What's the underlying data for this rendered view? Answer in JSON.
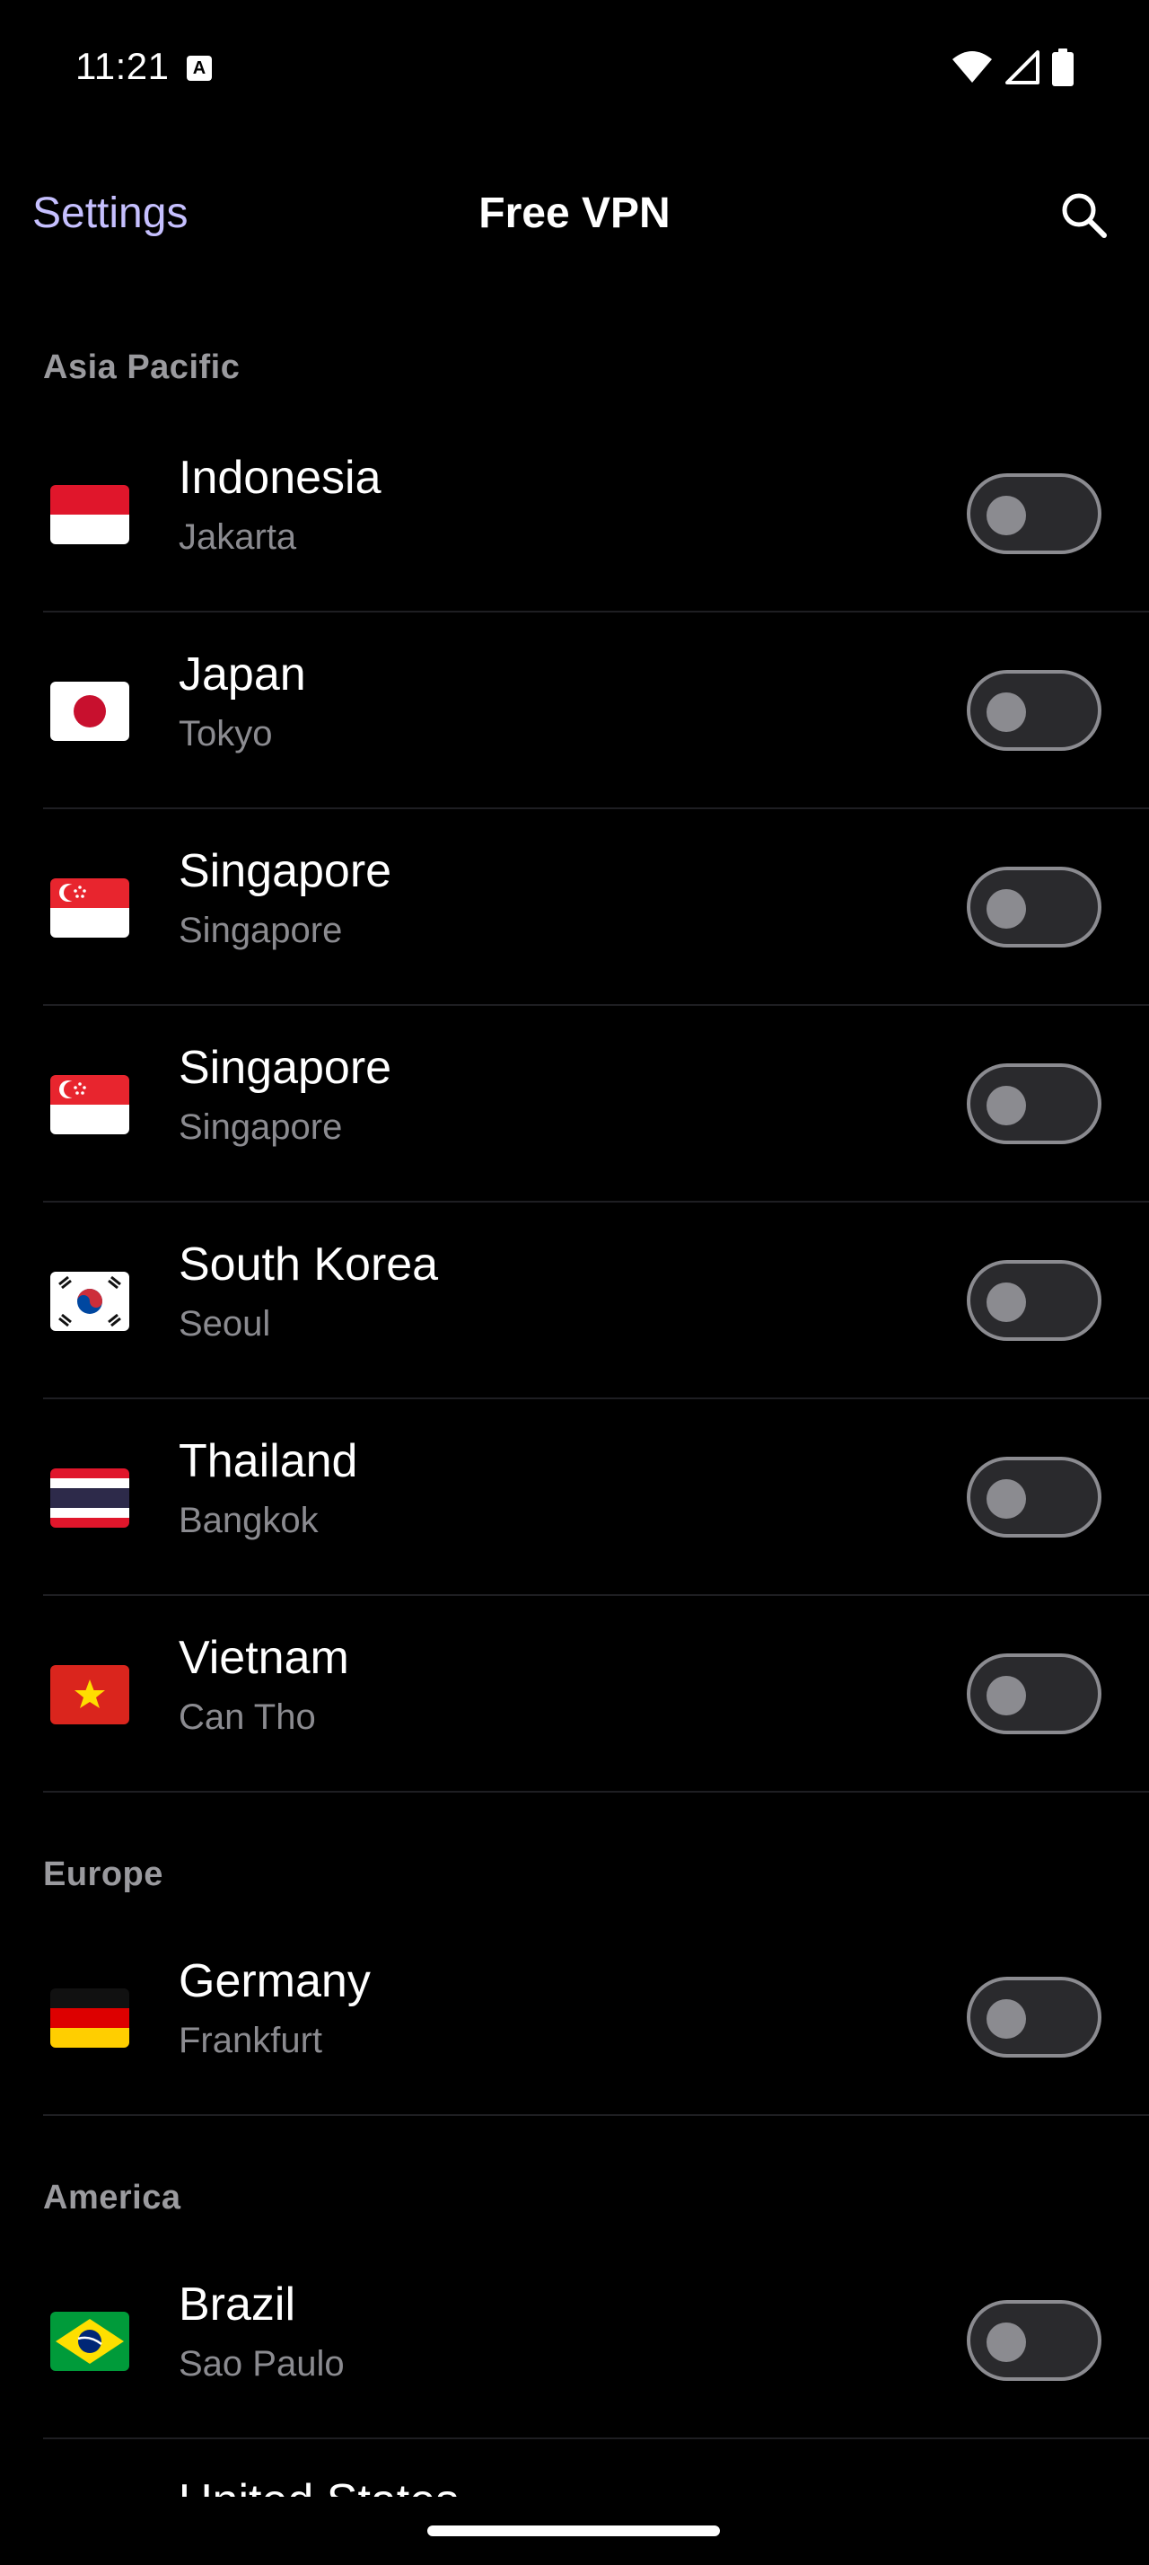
{
  "status_bar": {
    "time": "11:21",
    "notification_badge": "A",
    "icons": [
      "wifi-icon",
      "signal-icon",
      "battery-icon"
    ]
  },
  "app_bar": {
    "settings_label": "Settings",
    "title": "Free VPN",
    "search_icon": "search-icon"
  },
  "colors": {
    "accent": "#c6c0ff",
    "background": "#000000",
    "secondary_text": "#8b8b90",
    "section_header": "#9a9a9e",
    "toggle_off_track": "#2a2a2d",
    "toggle_off_border": "#8b8b90"
  },
  "sections": [
    {
      "title": "Asia Pacific",
      "servers": [
        {
          "country": "Indonesia",
          "city": "Jakarta",
          "flag": "indonesia-flag-icon",
          "enabled": false
        },
        {
          "country": "Japan",
          "city": "Tokyo",
          "flag": "japan-flag-icon",
          "enabled": false
        },
        {
          "country": "Singapore",
          "city": "Singapore",
          "flag": "singapore-flag-icon",
          "enabled": false
        },
        {
          "country": "Singapore",
          "city": "Singapore",
          "flag": "singapore-flag-icon",
          "enabled": false
        },
        {
          "country": "South Korea",
          "city": "Seoul",
          "flag": "south-korea-flag-icon",
          "enabled": false
        },
        {
          "country": "Thailand",
          "city": "Bangkok",
          "flag": "thailand-flag-icon",
          "enabled": false
        },
        {
          "country": "Vietnam",
          "city": "Can Tho",
          "flag": "vietnam-flag-icon",
          "enabled": false
        }
      ]
    },
    {
      "title": "Europe",
      "servers": [
        {
          "country": "Germany",
          "city": "Frankfurt",
          "flag": "germany-flag-icon",
          "enabled": false
        }
      ]
    },
    {
      "title": "America",
      "servers": [
        {
          "country": "Brazil",
          "city": "Sao Paulo",
          "flag": "brazil-flag-icon",
          "enabled": false
        },
        {
          "country": "United States",
          "city": "",
          "flag": "united-states-flag-icon",
          "enabled": false
        }
      ]
    }
  ]
}
